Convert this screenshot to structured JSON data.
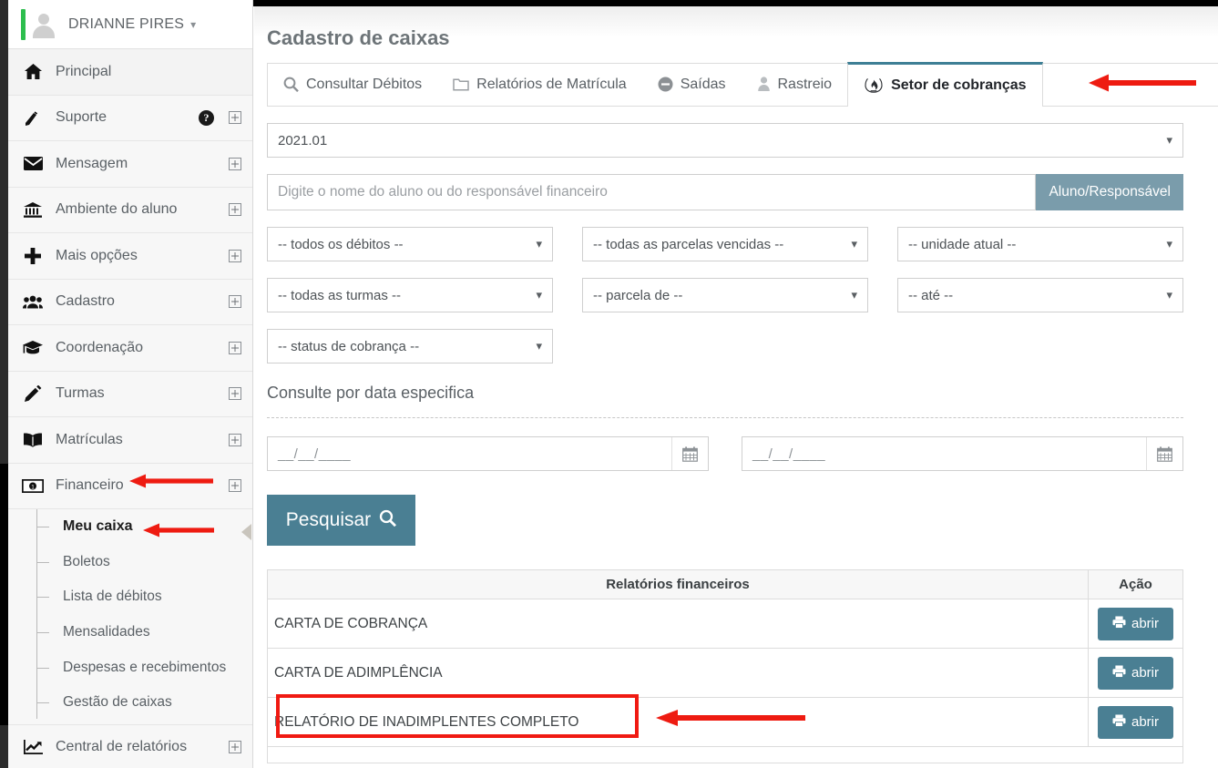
{
  "sidebar": {
    "user": {
      "name": "DRIANNE PIRES",
      "caret": "chevron-down"
    },
    "items": [
      {
        "label": "Principal",
        "icon": "home-icon",
        "expandable": false,
        "help": false
      },
      {
        "label": "Suporte",
        "icon": "support-icon",
        "expandable": true,
        "help": true
      },
      {
        "label": "Mensagem",
        "icon": "envelope-icon",
        "expandable": true,
        "help": false
      },
      {
        "label": "Ambiente do aluno",
        "icon": "bank-icon",
        "expandable": true,
        "help": false
      },
      {
        "label": "Mais opções",
        "icon": "plus-icon",
        "expandable": true,
        "help": false
      },
      {
        "label": "Cadastro",
        "icon": "users-icon",
        "expandable": true,
        "help": false
      },
      {
        "label": "Coordenação",
        "icon": "graduation-cap-icon",
        "expandable": true,
        "help": false
      },
      {
        "label": "Turmas",
        "icon": "pencil-icon",
        "expandable": true,
        "help": false
      },
      {
        "label": "Matrículas",
        "icon": "book-icon",
        "expandable": true,
        "help": false
      },
      {
        "label": "Financeiro",
        "icon": "money-bill-icon",
        "expandable": true,
        "help": false
      }
    ],
    "financeiro_sub": [
      {
        "label": "Meu caixa",
        "active": true
      },
      {
        "label": "Boletos",
        "active": false
      },
      {
        "label": "Lista de débitos",
        "active": false
      },
      {
        "label": "Mensalidades",
        "active": false
      },
      {
        "label": "Despesas e recebimentos",
        "active": false
      },
      {
        "label": "Gestão de caixas",
        "active": false
      }
    ],
    "footer_item": {
      "label": "Central de relatórios",
      "icon": "chart-line-icon",
      "expandable": true
    }
  },
  "main": {
    "page_title": "Cadastro de caixas",
    "tabs": [
      {
        "label": "Consultar Débitos",
        "icon": "search-icon",
        "active": false
      },
      {
        "label": "Relatórios de Matrícula",
        "icon": "folder-icon",
        "active": false
      },
      {
        "label": "Saídas",
        "icon": "minus-circle-icon",
        "active": false
      },
      {
        "label": "Rastreio",
        "icon": "ghost-icon",
        "active": false
      },
      {
        "label": "Setor de cobranças",
        "icon": "fire-icon",
        "active": true
      }
    ],
    "period_select": {
      "value": "2021.01"
    },
    "name_search": {
      "placeholder": "Digite o nome do aluno ou do responsável financeiro",
      "value": "",
      "button_label": "Aluno/Responsável"
    },
    "filters": [
      {
        "name": "debitos",
        "value": "-- todos os débitos --"
      },
      {
        "name": "parcelas-vencidas",
        "value": "-- todas as parcelas vencidas --"
      },
      {
        "name": "unidade",
        "value": "-- unidade atual --"
      },
      {
        "name": "turmas",
        "value": "-- todas as turmas --"
      },
      {
        "name": "parcela-de",
        "value": "-- parcela de --"
      },
      {
        "name": "ate",
        "value": "-- até --"
      },
      {
        "name": "status-cobranca",
        "value": "-- status de cobrança --"
      }
    ],
    "date_section": {
      "label": "Consulte por data especifica",
      "from_placeholder": "__/__/____",
      "to_placeholder": "__/__/____",
      "from_value": "",
      "to_value": ""
    },
    "search_button": {
      "label": "Pesquisar",
      "icon": "search-icon"
    },
    "table": {
      "headers": [
        "Relatórios financeiros",
        "Ação"
      ],
      "rows": [
        {
          "name": "CARTA DE COBRANÇA",
          "action_label": "abrir",
          "highlighted": false
        },
        {
          "name": "CARTA DE ADIMPLÊNCIA",
          "action_label": "abrir",
          "highlighted": false
        },
        {
          "name": "RELATÓRIO DE INADIMPLENTES COMPLETO",
          "action_label": "abrir",
          "highlighted": true
        }
      ]
    }
  },
  "colors": {
    "accent": "#4a7f93",
    "tab_active_border": "#3e7f95",
    "annotation_red": "#f01a12",
    "user_green": "#2dbe4e",
    "search_btn": "#7a9cab"
  },
  "annotations": [
    {
      "name": "arrow-setor-cobrancas",
      "target": "Setor de cobranças tab"
    },
    {
      "name": "arrow-financeiro",
      "target": "Financeiro sidebar item"
    },
    {
      "name": "arrow-meu-caixa",
      "target": "Meu caixa sidebar item"
    },
    {
      "name": "arrow-relatorio-inadimplentes",
      "target": "RELATÓRIO DE INADIMPLENTES COMPLETO row"
    },
    {
      "name": "box-relatorio-inadimplentes",
      "target": "RELATÓRIO DE INADIMPLENTES COMPLETO row"
    }
  ]
}
